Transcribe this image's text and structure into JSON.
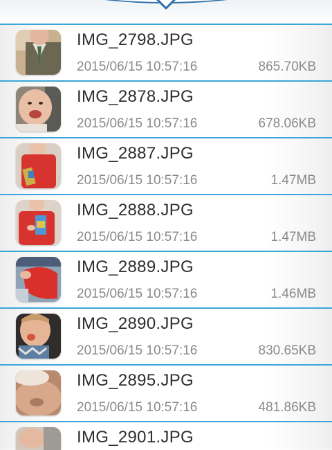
{
  "files": [
    {
      "name": "IMG_2798.JPG",
      "date": "2015/06/15 10:57:16",
      "size": "865.70KB",
      "thumb": "suit-baby-thumbnail"
    },
    {
      "name": "IMG_2878.JPG",
      "date": "2015/06/15 10:57:16",
      "size": "678.06KB",
      "thumb": "smiling-baby-thumbnail"
    },
    {
      "name": "IMG_2887.JPG",
      "date": "2015/06/15 10:57:16",
      "size": "1.47MB",
      "thumb": "red-shirt-baby-thumbnail"
    },
    {
      "name": "IMG_2888.JPG",
      "date": "2015/06/15 10:57:16",
      "size": "1.47MB",
      "thumb": "red-shirt-baby-thumbnail"
    },
    {
      "name": "IMG_2889.JPG",
      "date": "2015/06/15 10:57:16",
      "size": "1.46MB",
      "thumb": "crawling-baby-thumbnail"
    },
    {
      "name": "IMG_2890.JPG",
      "date": "2015/06/15 10:57:16",
      "size": "830.65KB",
      "thumb": "baby-eating-thumbnail"
    },
    {
      "name": "IMG_2895.JPG",
      "date": "2015/06/15 10:57:16",
      "size": "481.86KB",
      "thumb": "blurry-closeup-thumbnail"
    },
    {
      "name": "IMG_2901.JPG",
      "date": "",
      "size": "",
      "thumb": "baby-thumbnail"
    }
  ],
  "colors": {
    "accent": "#3aa7d8",
    "header_blue": "#2f6fa8",
    "name_text": "#2e2e2e",
    "meta_text": "#8a8a8a"
  }
}
